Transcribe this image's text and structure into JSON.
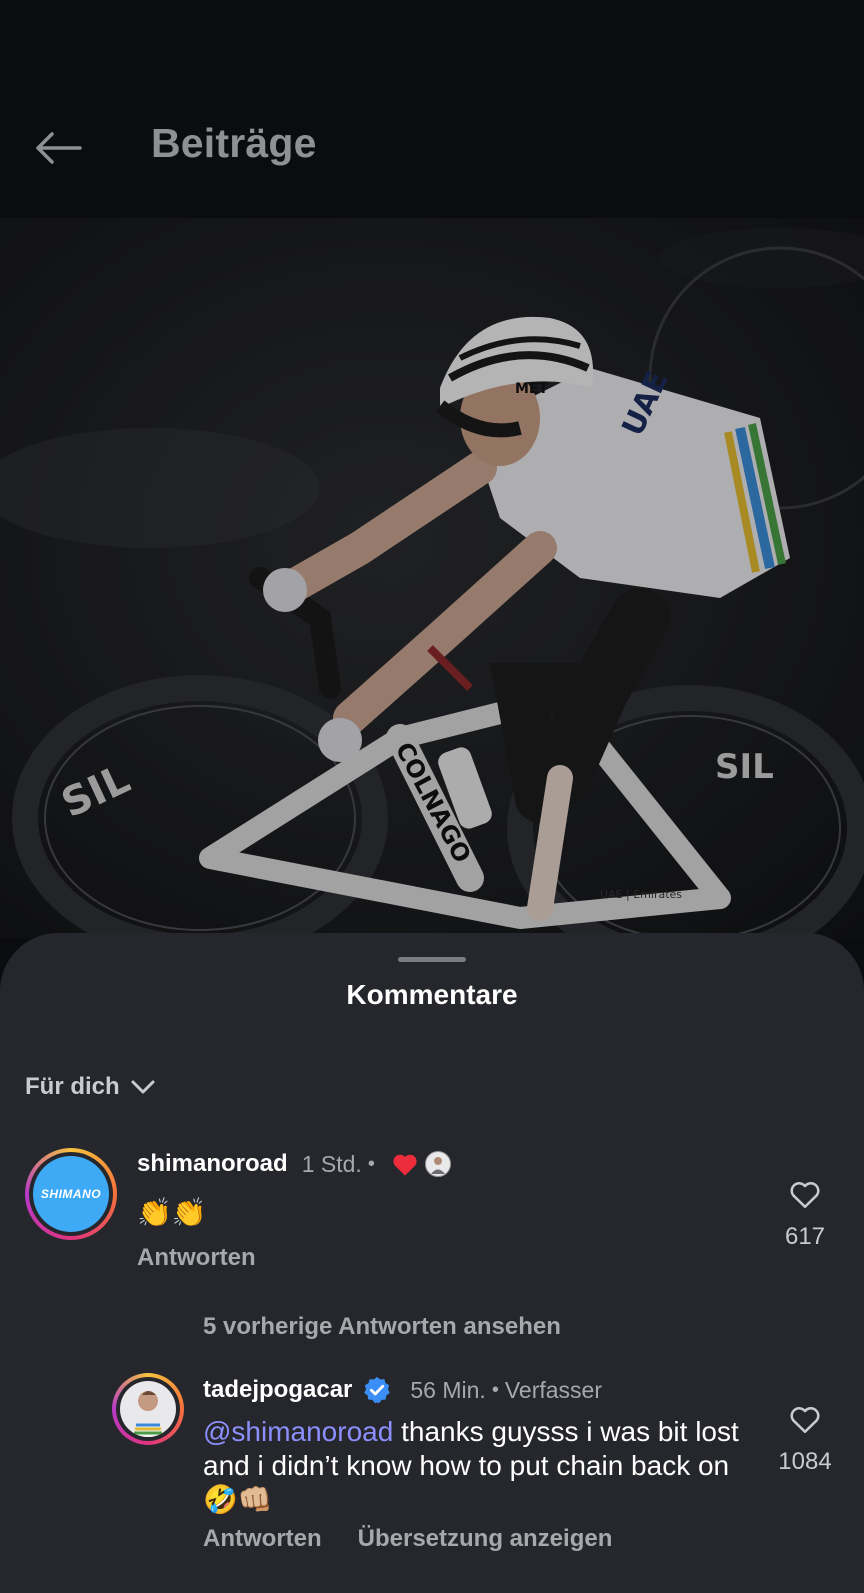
{
  "header": {
    "title": "Beiträge"
  },
  "sheet": {
    "title": "Kommentare",
    "filter_label": "Für dich"
  },
  "comments": [
    {
      "username": "shimanoroad",
      "time": "1 Std.",
      "text": "👏👏",
      "reply_label": "Antworten",
      "likes": "617",
      "avatar_text": "SHIMANO",
      "liked_by_author": true
    }
  ],
  "view_replies_label": "5 vorherige Antworten ansehen",
  "reply": {
    "username": "tadejpogacar",
    "verified": true,
    "time": "56 Min.",
    "role": "Verfasser",
    "mention": "@shimanoroad",
    "text": " thanks guysss i was bit lost and i didn’t know how to put chain back on🤣👊🏼",
    "reply_label": "Antworten",
    "translate_label": "Übersetzung anzeigen",
    "likes": "1084"
  },
  "photo": {
    "bike_brand": "COLNAGO",
    "team_text": "UAE",
    "frame_text": "UAE | Emirates",
    "helmet_text": "MET"
  },
  "colors": {
    "background": "#0b0c0f",
    "sheet": "#25272c",
    "mention": "#8c8ffb",
    "like_heart": "#ee2d3c",
    "verified": "#3a8ef6",
    "shimano_blue": "#3ea9f5"
  }
}
